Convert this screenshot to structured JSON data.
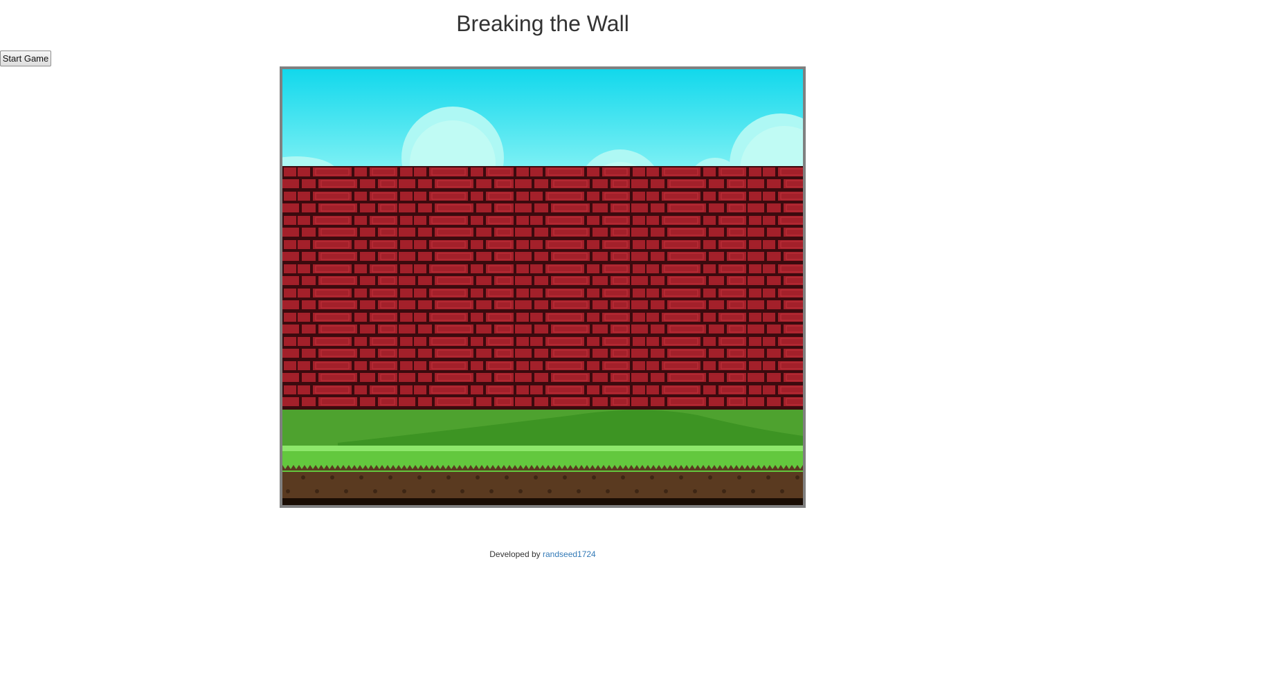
{
  "page": {
    "title": "Breaking the Wall"
  },
  "controls": {
    "start_label": "Start Game"
  },
  "game": {
    "scene": {
      "sky_colors": [
        "#12d8ec",
        "#7cf0f4"
      ],
      "cloud_color": "#c0fbf4",
      "brick_color": "#a3202a",
      "mortar_color": "#3b0a0e",
      "grass_color": "#4ea22f",
      "dirt_color": "#5a3a20"
    }
  },
  "footer": {
    "prefix": "Developed by",
    "author": "randseed1724"
  }
}
